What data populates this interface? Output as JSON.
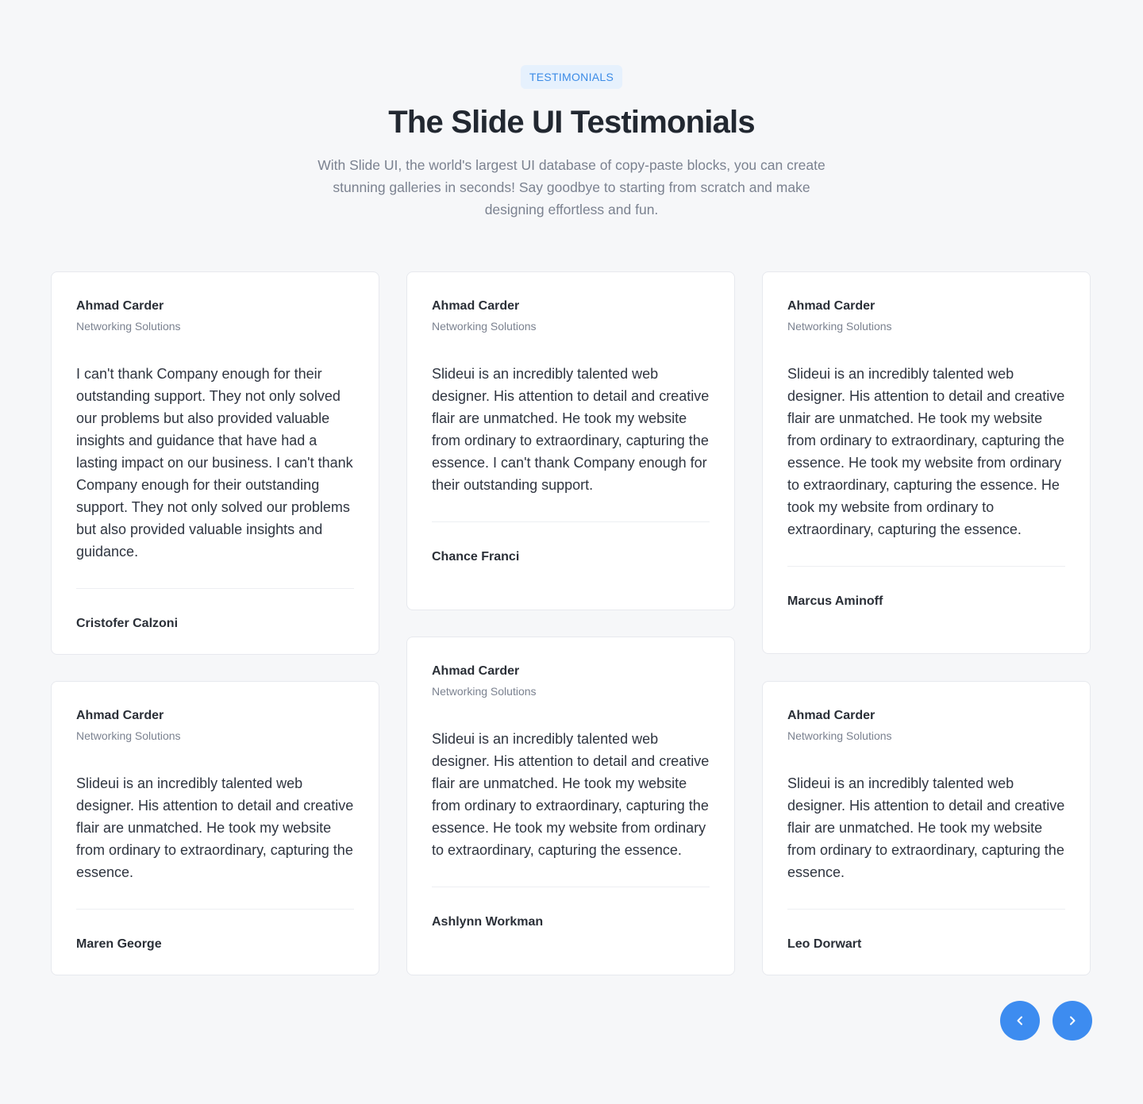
{
  "header": {
    "badge": "TESTIMONIALS",
    "title": "The Slide UI Testimonials",
    "subtitle": "With Slide UI, the world's largest UI database of copy-paste blocks, you can create stunning galleries in seconds! Say goodbye to starting from scratch and make designing effortless and fun."
  },
  "cards": [
    {
      "name": "Ahmad Carder",
      "company": "Networking Solutions",
      "quote": "I can't thank Company enough for their outstanding support. They not only solved our problems but also provided valuable insights and guidance that have had a lasting impact on our business. I can't thank Company enough for their outstanding support. They not only solved our problems but also provided valuable insights and guidance.",
      "author": "Cristofer Calzoni"
    },
    {
      "name": "Ahmad Carder",
      "company": "Networking Solutions",
      "quote": "Slideui is an incredibly talented web designer. His attention to detail and creative flair are unmatched. He took my website from ordinary to extraordinary, capturing the essence. I can't thank Company enough for their outstanding support.",
      "author": "Chance Franci"
    },
    {
      "name": "Ahmad Carder",
      "company": "Networking Solutions",
      "quote": "Slideui is an incredibly talented web designer. His attention to detail and creative flair are unmatched. He took my website from ordinary to extraordinary, capturing the essence. He took my website from ordinary to extraordinary, capturing the essence. He took my website from ordinary to extraordinary, capturing the essence.",
      "author": "Marcus Aminoff"
    },
    {
      "name": "Ahmad Carder",
      "company": "Networking Solutions",
      "quote": "Slideui is an incredibly talented web designer. His attention to detail and creative flair are unmatched. He took my website from ordinary to extraordinary, capturing the essence.",
      "author": "Maren George"
    },
    {
      "name": "Ahmad Carder",
      "company": "Networking Solutions",
      "quote": "Slideui is an incredibly talented web designer. His attention to detail and creative flair are unmatched. He took my website from ordinary to extraordinary, capturing the essence. He took my website from ordinary to extraordinary, capturing the essence.",
      "author": "Ashlynn Workman"
    },
    {
      "name": "Ahmad Carder",
      "company": "Networking Solutions",
      "quote": "Slideui is an incredibly talented web designer. His attention to detail and creative flair are unmatched. He took my website from ordinary to extraordinary, capturing the essence.",
      "author": "Leo Dorwart"
    }
  ],
  "nav": {
    "prev_icon": "chevron-left-icon",
    "next_icon": "chevron-right-icon"
  },
  "colors": {
    "accent": "#3d8cf0",
    "badge_bg": "#e6f1fd",
    "badge_text": "#3b8be6",
    "page_bg": "#f6f7f9"
  }
}
